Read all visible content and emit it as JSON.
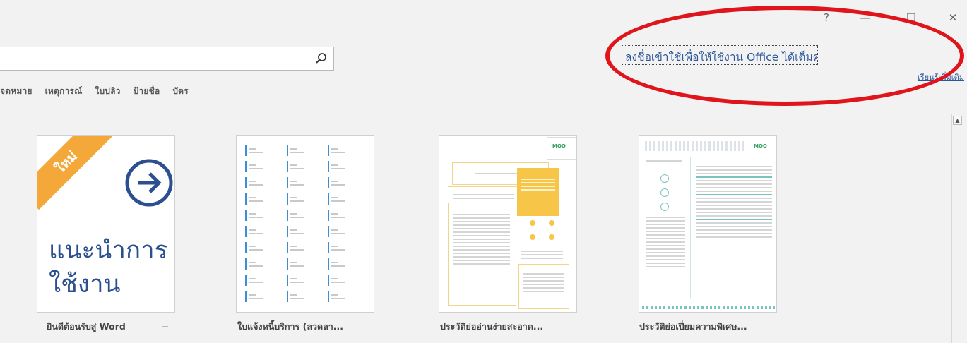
{
  "window": {
    "help_label": "?",
    "minimize_label": "—",
    "restore_label": "❐",
    "close_label": "✕"
  },
  "search": {
    "value": "",
    "placeholder": ""
  },
  "suggested_searches": [
    "จดหมาย",
    "เหตุการณ์",
    "ใบปลิว",
    "ป้ายชื่อ",
    "บัตร"
  ],
  "account": {
    "signin_text": "ลงชื่อเข้าใช้เพื่อให้ใช้งาน Office ได้เต็มความสามารถ",
    "learn_more": "เรียนรู้เพิ่มเติม"
  },
  "templates": [
    {
      "title": "ยินดีต้อนรับสู่ Word",
      "badge": "ใหม่",
      "body_line1": "แนะนำการ",
      "body_line2": "ใช้งาน"
    },
    {
      "title": "ใบแจ้งหนี้บริการ (ลวดลา..."
    },
    {
      "title": "ประวัติย่ออ่านง่ายสะอาด...",
      "logo": "MOO"
    },
    {
      "title": "ประวัติย่อเปี่ยมความพิเศษ...",
      "logo": "MOO"
    }
  ],
  "colors": {
    "accent": "#2b579a",
    "annotation_circle": "#e0141b",
    "new_badge": "#f4a83a",
    "resume_highlight": "#f7c548",
    "logo_green": "#2e9e5b"
  }
}
